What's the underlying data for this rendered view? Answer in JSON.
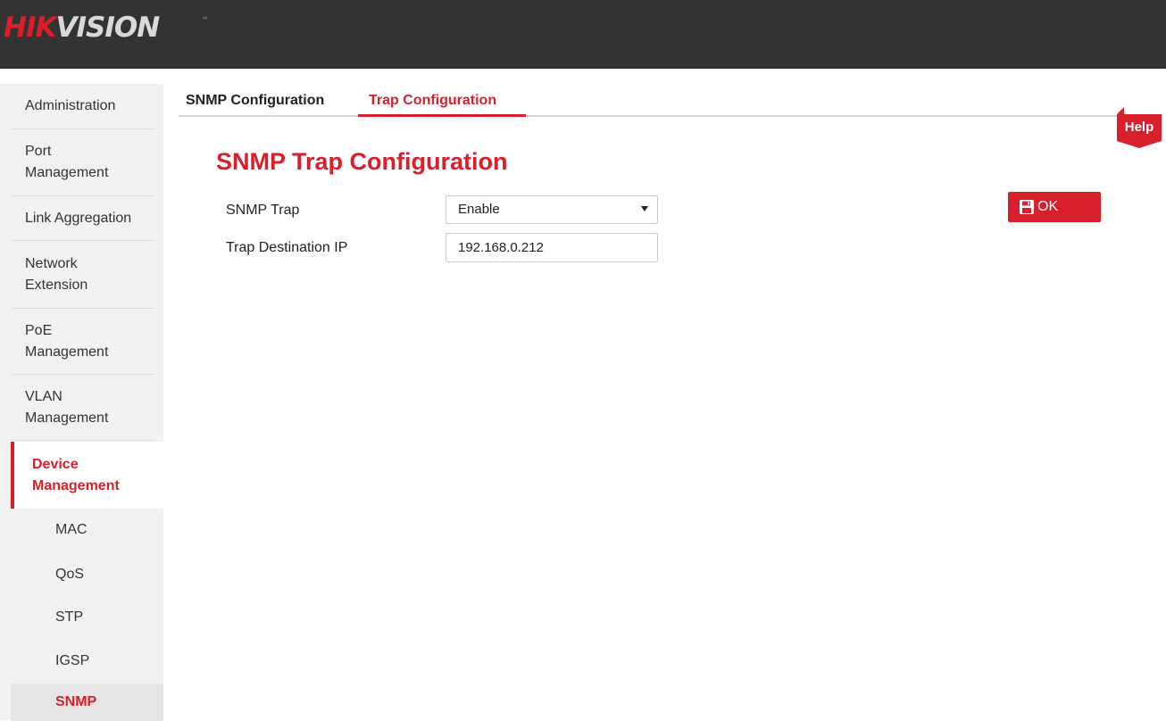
{
  "brand": {
    "part1": "HIK",
    "part2": "VISION",
    "tm": "™"
  },
  "sidebar": {
    "items": [
      {
        "label": "Administration"
      },
      {
        "label": "Port\nManagement"
      },
      {
        "label": "Link Aggregation"
      },
      {
        "label": "Network\nExtension"
      },
      {
        "label": "PoE\nManagement"
      },
      {
        "label": "VLAN\nManagement"
      },
      {
        "label": "Device\nManagement"
      }
    ],
    "subitems": [
      {
        "label": "MAC"
      },
      {
        "label": "QoS"
      },
      {
        "label": "STP"
      },
      {
        "label": "IGSP"
      },
      {
        "label": "SNMP"
      }
    ]
  },
  "tabs": [
    {
      "label": "SNMP Configuration"
    },
    {
      "label": "Trap Configuration"
    }
  ],
  "help": {
    "label": "Help"
  },
  "page": {
    "title": "SNMP Trap Configuration",
    "snmp_trap_label": "SNMP Trap",
    "snmp_trap_value": "Enable",
    "dest_ip_label": "Trap Destination IP",
    "dest_ip_value": "192.168.0.212"
  },
  "ok_button": {
    "label": "OK",
    "icon": "save-icon"
  },
  "colors": {
    "accent": "#d8202c",
    "topbar": "#333333",
    "sidebar": "#f2f2f2"
  }
}
